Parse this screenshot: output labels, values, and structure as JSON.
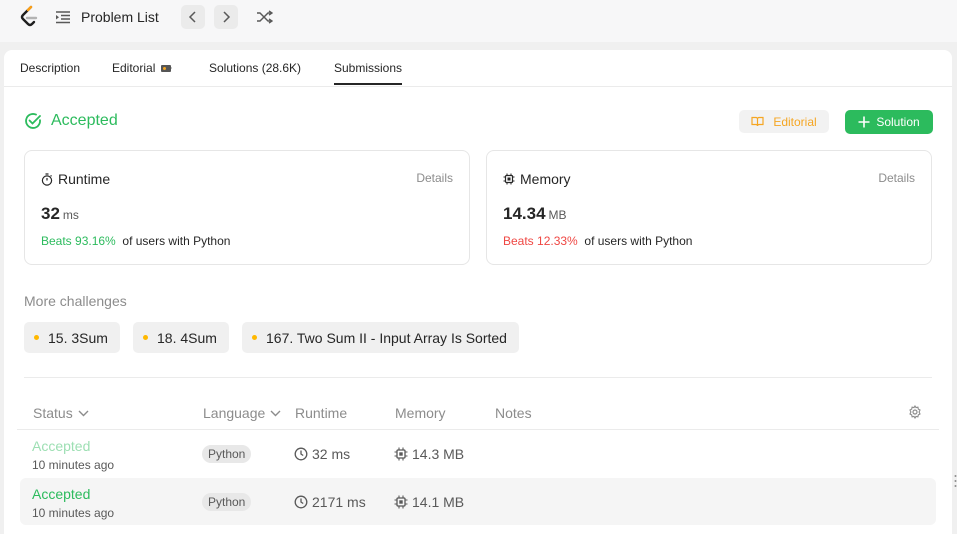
{
  "topbar": {
    "logo_icon": "leetcode-logo",
    "problem_list": "Problem List",
    "prev_icon": "chevron-left-icon",
    "next_icon": "chevron-right-icon",
    "shuffle_icon": "shuffle-icon"
  },
  "tabs": [
    {
      "label": "Description"
    },
    {
      "label": "Editorial"
    },
    {
      "label": "Solutions (28.6K)"
    },
    {
      "label": "Submissions",
      "active": true
    }
  ],
  "result": {
    "status": "Accepted",
    "editorial_button": "Editorial",
    "solution_button": "Solution"
  },
  "runtime": {
    "title": "Runtime",
    "details": "Details",
    "value": "32",
    "unit": "ms",
    "beats": "Beats 93.16%",
    "suffix": "of users with Python"
  },
  "memory": {
    "title": "Memory",
    "details": "Details",
    "value": "14.34",
    "unit": "MB",
    "beats": "Beats 12.33%",
    "suffix": "of users with Python"
  },
  "more": {
    "title": "More challenges",
    "items": [
      "15. 3Sum",
      "18. 4Sum",
      "167. Two Sum II - Input Array Is Sorted"
    ]
  },
  "table": {
    "headers": {
      "status": "Status",
      "language": "Language",
      "runtime": "Runtime",
      "memory": "Memory",
      "notes": "Notes"
    },
    "rows": [
      {
        "status": "Accepted",
        "time": "10 minutes ago",
        "language": "Python",
        "runtime": "32 ms",
        "memory": "14.3 MB"
      },
      {
        "status": "Accepted",
        "time": "10 minutes ago",
        "language": "Python",
        "runtime": "2171 ms",
        "memory": "14.1 MB"
      }
    ]
  },
  "colors": {
    "accent_green": "#2cbb5d",
    "warning_orange": "#f5a623",
    "danger_red": "#ef4743",
    "challenge_dot": "#ffb800"
  }
}
